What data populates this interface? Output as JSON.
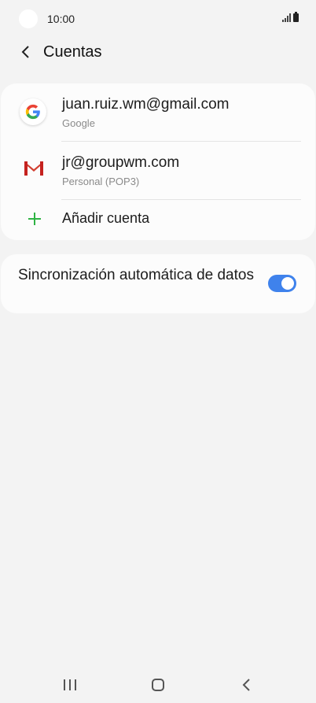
{
  "status_bar": {
    "time": "10:00"
  },
  "header": {
    "title": "Cuentas"
  },
  "accounts": [
    {
      "email": "juan.ruiz.wm@gmail.com",
      "type": "Google",
      "icon": "google-icon"
    },
    {
      "email": "jr@groupwm.com",
      "type": "Personal (POP3)",
      "icon": "gmail-icon"
    }
  ],
  "add_account": {
    "label": "Añadir cuenta"
  },
  "sync": {
    "label": "Sincronización automática de datos",
    "enabled": true
  },
  "colors": {
    "accent": "#3f82ec",
    "add_green": "#2fb344",
    "background": "#f3f3f3"
  }
}
